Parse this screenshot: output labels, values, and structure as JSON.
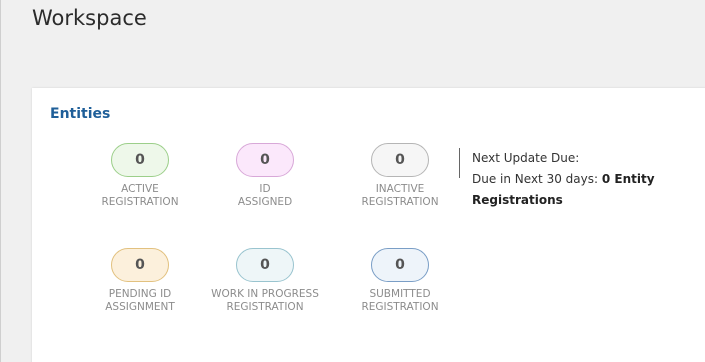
{
  "page": {
    "title": "Workspace"
  },
  "entities_card": {
    "title": "Entities",
    "tiles": [
      {
        "value": "0",
        "label_line1": "ACTIVE",
        "label_line2": "REGISTRATION",
        "bg": "#eef8ea",
        "border": "#9ccf8a"
      },
      {
        "value": "0",
        "label_line1": "ID",
        "label_line2": "ASSIGNED",
        "bg": "#fbe8fb",
        "border": "#d8a8d8"
      },
      {
        "value": "0",
        "label_line1": "INACTIVE",
        "label_line2": "REGISTRATION",
        "bg": "#f6f6f6",
        "border": "#b5b5b5"
      },
      {
        "value": "0",
        "label_line1": "PENDING ID",
        "label_line2": "ASSIGNMENT",
        "bg": "#fcf0dc",
        "border": "#e2c17f"
      },
      {
        "value": "0",
        "label_line1": "WORK IN PROGRESS",
        "label_line2": "REGISTRATION",
        "bg": "#eef6f8",
        "border": "#99c4cf"
      },
      {
        "value": "0",
        "label_line1": "SUBMITTED",
        "label_line2": "REGISTRATION",
        "bg": "#eef4fa",
        "border": "#7a9ec6"
      }
    ],
    "next_update": {
      "heading": "Next Update Due:",
      "due_prefix": "Due in Next 30 days:",
      "due_count_text": "0 Entity",
      "due_suffix": "Registrations"
    }
  }
}
